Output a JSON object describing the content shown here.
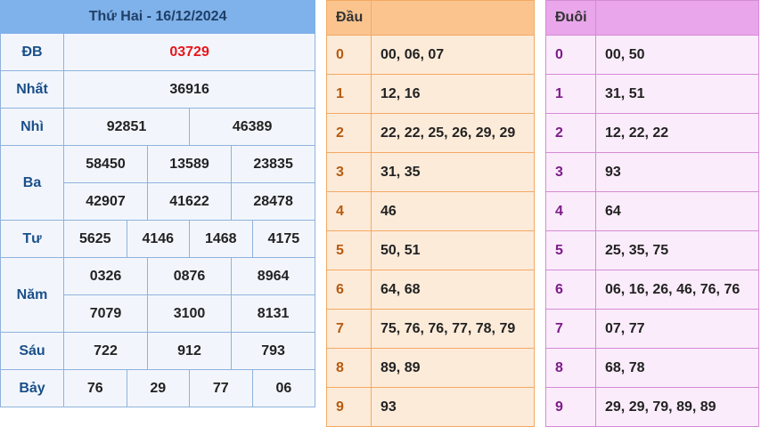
{
  "results": {
    "title": "Thứ Hai - 16/12/2024",
    "db": {
      "label": "ĐB",
      "value": "03729"
    },
    "nhat": {
      "label": "Nhất",
      "value": "36916"
    },
    "nhi": {
      "label": "Nhì",
      "values": [
        "92851",
        "46389"
      ]
    },
    "ba": {
      "label": "Ba",
      "values": [
        "58450",
        "13589",
        "23835",
        "42907",
        "41622",
        "28478"
      ]
    },
    "tu": {
      "label": "Tư",
      "values": [
        "5625",
        "4146",
        "1468",
        "4175"
      ]
    },
    "nam": {
      "label": "Năm",
      "values": [
        "0326",
        "0876",
        "8964",
        "7079",
        "3100",
        "8131"
      ]
    },
    "sau": {
      "label": "Sáu",
      "values": [
        "722",
        "912",
        "793"
      ]
    },
    "bay": {
      "label": "Bảy",
      "values": [
        "76",
        "29",
        "77",
        "06"
      ]
    }
  },
  "dau": {
    "header": "Đầu",
    "rows": [
      {
        "digit": "0",
        "values": "00, 06, 07"
      },
      {
        "digit": "1",
        "values": "12, 16"
      },
      {
        "digit": "2",
        "values": "22, 22, 25, 26, 29, 29"
      },
      {
        "digit": "3",
        "values": "31, 35"
      },
      {
        "digit": "4",
        "values": "46"
      },
      {
        "digit": "5",
        "values": "50, 51"
      },
      {
        "digit": "6",
        "values": "64, 68"
      },
      {
        "digit": "7",
        "values": "75, 76, 76, 77, 78, 79"
      },
      {
        "digit": "8",
        "values": "89, 89"
      },
      {
        "digit": "9",
        "values": "93"
      }
    ]
  },
  "duoi": {
    "header": "Đuôi",
    "rows": [
      {
        "digit": "0",
        "values": "00, 50"
      },
      {
        "digit": "1",
        "values": "31, 51"
      },
      {
        "digit": "2",
        "values": "12, 22, 22"
      },
      {
        "digit": "3",
        "values": "93"
      },
      {
        "digit": "4",
        "values": "64"
      },
      {
        "digit": "5",
        "values": "25, 35, 75"
      },
      {
        "digit": "6",
        "values": "06, 16, 26, 46, 76, 76"
      },
      {
        "digit": "7",
        "values": "07, 77"
      },
      {
        "digit": "8",
        "values": "68, 78"
      },
      {
        "digit": "9",
        "values": "29, 29, 79, 89, 89"
      }
    ]
  },
  "colors": {
    "results_header": "#7fb1ea",
    "results_border": "#8fb2dd",
    "special_prize": "#e8151b",
    "prize_label": "#1a4f8a",
    "dau_header": "#fbc48f",
    "dau_bg": "#fdebd9",
    "duoi_header": "#e9a6ea",
    "duoi_bg": "#fbecfb"
  }
}
